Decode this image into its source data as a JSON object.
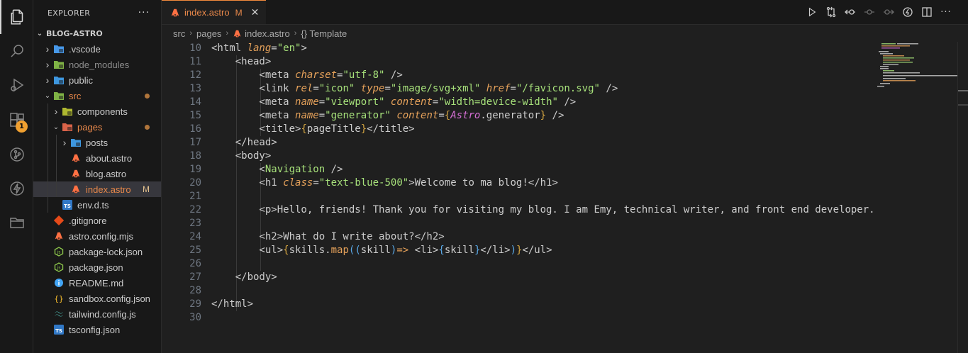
{
  "explorer": {
    "title": "EXPLORER",
    "more": "···",
    "section": "BLOG-ASTRO",
    "tree": [
      {
        "label": ".vscode",
        "type": "folder",
        "depth": 0,
        "expanded": false,
        "icon": "vscode-folder-icon",
        "color": "#4da6ff"
      },
      {
        "label": "node_modules",
        "type": "folder",
        "depth": 0,
        "expanded": false,
        "icon": "node-folder-icon",
        "color": "#8bc34a",
        "dim": true
      },
      {
        "label": "public",
        "type": "folder",
        "depth": 0,
        "expanded": false,
        "icon": "public-folder-icon",
        "color": "#42a5f5"
      },
      {
        "label": "src",
        "type": "folder",
        "depth": 0,
        "expanded": true,
        "icon": "src-folder-icon",
        "color": "#8bc34a",
        "orange": true,
        "dot": true
      },
      {
        "label": "components",
        "type": "folder",
        "depth": 1,
        "expanded": false,
        "icon": "components-folder-icon",
        "color": "#c0ca33"
      },
      {
        "label": "pages",
        "type": "folder",
        "depth": 1,
        "expanded": true,
        "icon": "pages-folder-icon",
        "color": "#ef6c4f",
        "orange": true,
        "dot": true
      },
      {
        "label": "posts",
        "type": "folder",
        "depth": 2,
        "expanded": false,
        "icon": "posts-folder-icon",
        "color": "#42a5f5"
      },
      {
        "label": "about.astro",
        "type": "file",
        "depth": 2,
        "icon": "astro-file-icon",
        "color": "#ff7043"
      },
      {
        "label": "blog.astro",
        "type": "file",
        "depth": 2,
        "icon": "astro-file-icon",
        "color": "#ff7043"
      },
      {
        "label": "index.astro",
        "type": "file",
        "depth": 2,
        "icon": "astro-file-icon",
        "color": "#ff7043",
        "orange": true,
        "selected": true,
        "mod": "M"
      },
      {
        "label": "env.d.ts",
        "type": "file",
        "depth": 1,
        "icon": "ts-file-icon",
        "color": "#3178c6"
      },
      {
        "label": ".gitignore",
        "type": "file",
        "depth": 0,
        "icon": "git-file-icon",
        "color": "#e64a19"
      },
      {
        "label": "astro.config.mjs",
        "type": "file",
        "depth": 0,
        "icon": "astro-file-icon",
        "color": "#ff7043"
      },
      {
        "label": "package-lock.json",
        "type": "file",
        "depth": 0,
        "icon": "npm-file-icon",
        "color": "#8bc34a"
      },
      {
        "label": "package.json",
        "type": "file",
        "depth": 0,
        "icon": "npm-file-icon",
        "color": "#8bc34a"
      },
      {
        "label": "README.md",
        "type": "file",
        "depth": 0,
        "icon": "info-file-icon",
        "color": "#42a5f5"
      },
      {
        "label": "sandbox.config.json",
        "type": "file",
        "depth": 0,
        "icon": "json-file-icon",
        "color": "#fbc02d"
      },
      {
        "label": "tailwind.config.js",
        "type": "file",
        "depth": 0,
        "icon": "tailwind-file-icon",
        "color": "#4db6ac"
      },
      {
        "label": "tsconfig.json",
        "type": "file",
        "depth": 0,
        "icon": "ts-file-icon",
        "color": "#3178c6"
      }
    ]
  },
  "activity": {
    "extensions_badge": "1"
  },
  "tab": {
    "name": "index.astro",
    "modified": "M",
    "close": "✕"
  },
  "breadcrumb": {
    "items": [
      "src",
      "pages",
      "index.astro",
      "{} Template"
    ]
  },
  "editor": {
    "line_numbers": [
      "10",
      "11",
      "12",
      "13",
      "14",
      "15",
      "16",
      "17",
      "18",
      "19",
      "20",
      "21",
      "22",
      "23",
      "24",
      "25",
      "26",
      "27",
      "28",
      "29",
      "30"
    ],
    "lines": [
      [
        {
          "t": "tag",
          "v": "<html "
        },
        {
          "t": "attr",
          "v": "lang"
        },
        {
          "t": "tag",
          "v": "="
        },
        {
          "t": "str",
          "v": "\"en\""
        },
        {
          "t": "tag",
          "v": ">"
        }
      ],
      [
        {
          "t": "tag",
          "v": "    <head>"
        }
      ],
      [
        {
          "t": "tag",
          "v": "        <meta "
        },
        {
          "t": "attr",
          "v": "charset"
        },
        {
          "t": "tag",
          "v": "="
        },
        {
          "t": "str",
          "v": "\"utf-8\""
        },
        {
          "t": "tag",
          "v": " />"
        }
      ],
      [
        {
          "t": "tag",
          "v": "        <link "
        },
        {
          "t": "attr",
          "v": "rel"
        },
        {
          "t": "tag",
          "v": "="
        },
        {
          "t": "str",
          "v": "\"icon\""
        },
        {
          "t": "tag",
          "v": " "
        },
        {
          "t": "attr",
          "v": "type"
        },
        {
          "t": "tag",
          "v": "="
        },
        {
          "t": "str",
          "v": "\"image/svg+xml\""
        },
        {
          "t": "tag",
          "v": " "
        },
        {
          "t": "attr",
          "v": "href"
        },
        {
          "t": "tag",
          "v": "="
        },
        {
          "t": "str",
          "v": "\"/favicon.svg\""
        },
        {
          "t": "tag",
          "v": " />"
        }
      ],
      [
        {
          "t": "tag",
          "v": "        <meta "
        },
        {
          "t": "attr",
          "v": "name"
        },
        {
          "t": "tag",
          "v": "="
        },
        {
          "t": "str",
          "v": "\"viewport\""
        },
        {
          "t": "tag",
          "v": " "
        },
        {
          "t": "attr",
          "v": "content"
        },
        {
          "t": "tag",
          "v": "="
        },
        {
          "t": "str",
          "v": "\"width=device-width\""
        },
        {
          "t": "tag",
          "v": " />"
        }
      ],
      [
        {
          "t": "tag",
          "v": "        <meta "
        },
        {
          "t": "attr",
          "v": "name"
        },
        {
          "t": "tag",
          "v": "="
        },
        {
          "t": "str",
          "v": "\"generator\""
        },
        {
          "t": "tag",
          "v": " "
        },
        {
          "t": "attr",
          "v": "content"
        },
        {
          "t": "tag",
          "v": "="
        },
        {
          "t": "brace",
          "v": "{"
        },
        {
          "t": "astro",
          "v": "Astro"
        },
        {
          "t": "var",
          "v": ".generator"
        },
        {
          "t": "brace",
          "v": "}"
        },
        {
          "t": "tag",
          "v": " />"
        }
      ],
      [
        {
          "t": "tag",
          "v": "        <title>"
        },
        {
          "t": "brace",
          "v": "{"
        },
        {
          "t": "var",
          "v": "pageTitle"
        },
        {
          "t": "brace",
          "v": "}"
        },
        {
          "t": "tag",
          "v": "</title>"
        }
      ],
      [
        {
          "t": "tag",
          "v": "    </head>"
        }
      ],
      [
        {
          "t": "tag",
          "v": "    <body>"
        }
      ],
      [
        {
          "t": "tag",
          "v": "        <"
        },
        {
          "t": "comp",
          "v": "Navigation"
        },
        {
          "t": "tag",
          "v": " />"
        }
      ],
      [
        {
          "t": "tag",
          "v": "        <h1 "
        },
        {
          "t": "attr",
          "v": "class"
        },
        {
          "t": "tag",
          "v": "="
        },
        {
          "t": "str",
          "v": "\"text-blue-500\""
        },
        {
          "t": "tag",
          "v": ">Welcome to ma blog!</h1>"
        }
      ],
      [],
      [
        {
          "t": "tag",
          "v": "        <p>Hello, friends! Thank you for visiting my blog. I am Emy, technical writer, and front end developer."
        }
      ],
      [],
      [
        {
          "t": "tag",
          "v": "        <h2>What do I write about?</h2>"
        }
      ],
      [
        {
          "t": "tag",
          "v": "        <ul>"
        },
        {
          "t": "brace",
          "v": "{"
        },
        {
          "t": "var",
          "v": "skills."
        },
        {
          "t": "fn",
          "v": "map"
        },
        {
          "t": "paren",
          "v": "(("
        },
        {
          "t": "var",
          "v": "skill"
        },
        {
          "t": "paren",
          "v": ")"
        },
        {
          "t": "arrow",
          "v": "=>"
        },
        {
          "t": "tag",
          "v": " <li>"
        },
        {
          "t": "paren",
          "v": "{"
        },
        {
          "t": "var",
          "v": "skill"
        },
        {
          "t": "paren",
          "v": "}"
        },
        {
          "t": "tag",
          "v": "</li>"
        },
        {
          "t": "paren",
          "v": ")"
        },
        {
          "t": "brace",
          "v": "}"
        },
        {
          "t": "tag",
          "v": "</ul>"
        }
      ],
      [],
      [
        {
          "t": "tag",
          "v": "    </body>"
        }
      ],
      [],
      [
        {
          "t": "tag",
          "v": "</html>"
        }
      ],
      []
    ]
  },
  "colors": {
    "accent": "#f28a3c",
    "modified": "#e2c08d",
    "attr": "#e5a15a",
    "string": "#a6e07a"
  }
}
